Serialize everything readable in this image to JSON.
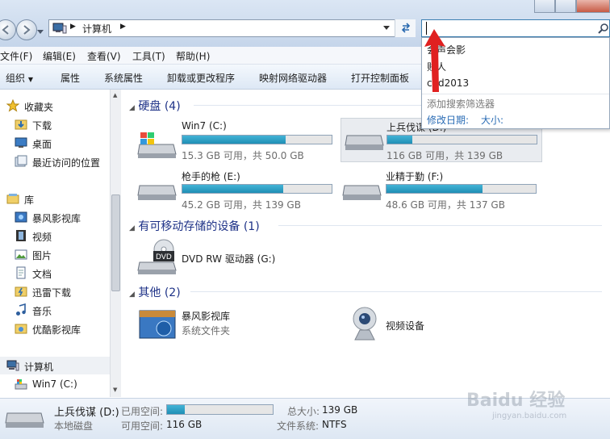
{
  "address": {
    "computer_label": "计算机"
  },
  "search": {
    "value": ""
  },
  "menu": [
    "文件(F)",
    "编辑(E)",
    "查看(V)",
    "工具(T)",
    "帮助(H)"
  ],
  "toolbar": [
    "组织",
    "属性",
    "系统属性",
    "卸载或更改程序",
    "映射网络驱动器",
    "打开控制面板"
  ],
  "nav": {
    "favorites_header": "收藏夹",
    "favorites": [
      "下载",
      "桌面",
      "最近访问的位置"
    ],
    "library_header": "库",
    "libraries": [
      "暴风影视库",
      "视频",
      "图片",
      "文档",
      "迅雷下载",
      "音乐",
      "优酷影视库"
    ],
    "computer_header": "计算机",
    "computer_items": [
      "Win7 (C:)"
    ]
  },
  "groups": {
    "hard_disks": "硬盘 (4)",
    "removable": "有可移动存储的设备 (1)",
    "other": "其他 (2)"
  },
  "drives": [
    {
      "name": "Win7 (C:)",
      "info": "15.3 GB 可用，共 50.0 GB",
      "used_fraction": 0.694
    },
    {
      "name": "上兵伐谋 (D:)",
      "info": "116 GB 可用，共 139 GB",
      "used_fraction": 0.165
    },
    {
      "name": "枪手的枪 (E:)",
      "info": "45.2 GB 可用，共 139 GB",
      "used_fraction": 0.675
    },
    {
      "name": "业精于勤 (F:)",
      "info": "48.6 GB 可用，共 137 GB",
      "used_fraction": 0.645
    }
  ],
  "removable_items": [
    {
      "name": "DVD RW 驱动器 (G:)"
    }
  ],
  "other_items": [
    {
      "name": "暴风影视库",
      "sub": "系统文件夹"
    },
    {
      "name": "视频设备",
      "sub": ""
    }
  ],
  "status": {
    "drive_name": "上兵伐谋 (D:)",
    "drive_type": "本地磁盘",
    "used_label": "已用空间:",
    "free_label": "可用空间:",
    "free_value": "116 GB",
    "total_label": "总大小:",
    "total_value": "139 GB",
    "fs_label": "文件系统:",
    "fs_value": "NTFS",
    "used_fraction": 0.165
  },
  "dropdown": {
    "suggestions": [
      "会声会影",
      "贱人",
      "cad2013"
    ],
    "filter_label": "添加搜索筛选器",
    "filters": [
      "修改日期:",
      "大小:"
    ]
  },
  "watermark": {
    "logo": "Baidu 经验",
    "url": "jingyan.baidu.com"
  },
  "colors": {
    "bar_fill": "#1f8fb5",
    "group_title": "#1e3287",
    "link": "#2a6cb5",
    "arrow": "#e02020"
  }
}
